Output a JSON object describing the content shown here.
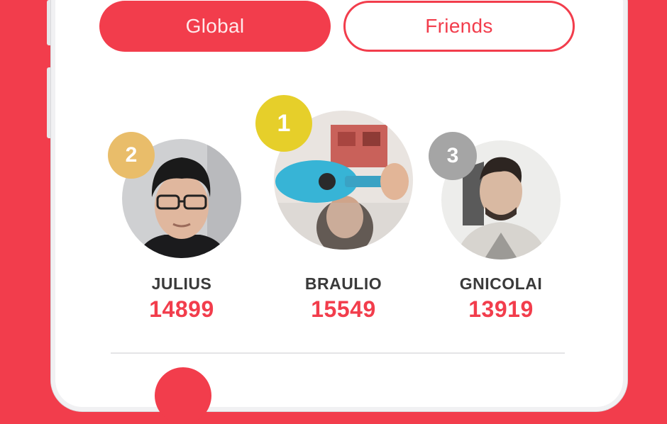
{
  "tabs": {
    "global_label": "Global",
    "friends_label": "Friends"
  },
  "leaderboard": [
    {
      "rank": "1",
      "name": "BRAULIO",
      "score": "15549",
      "badge_color": "#e6cf2a"
    },
    {
      "rank": "2",
      "name": "JULIUS",
      "score": "14899",
      "badge_color": "#e9bd6a"
    },
    {
      "rank": "3",
      "name": "GNICOLAI",
      "score": "13919",
      "badge_color": "#a5a5a5"
    }
  ],
  "colors": {
    "accent": "#f23d4c",
    "name_text": "#3a3a3a"
  }
}
